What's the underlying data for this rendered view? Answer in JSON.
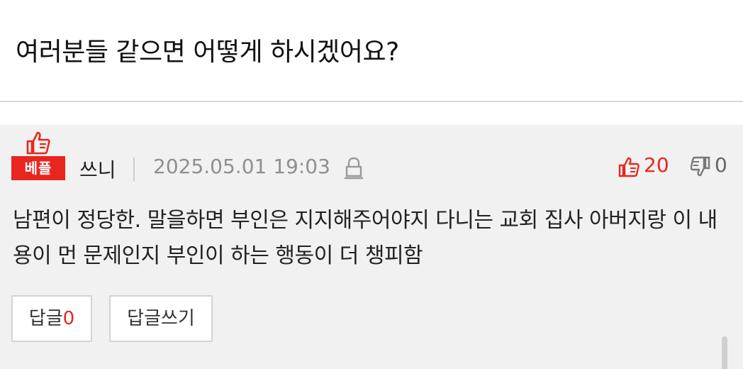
{
  "post": {
    "title": "여러분들 같으면 어떻게 하시겠어요?"
  },
  "comment": {
    "badge_label": "베플",
    "author": "쓰니",
    "date": "2025.05.01 19:03",
    "likes": "20",
    "dislikes": "0",
    "text": "남편이 정당한. 말을하면 부인은 지지해주어야지 다니는 교회 집사 아버지랑 이 내용이 먼 문제인지 부인이 하는 행동이 더 챙피함",
    "reply_label": "답글",
    "reply_count": "0",
    "write_reply_label": "답글쓰기"
  },
  "colors": {
    "accent": "#e8261f",
    "muted": "#8f8f8f",
    "comment_bg": "#f1f1f1"
  },
  "icons": [
    "thumbs-up-icon",
    "lock-icon",
    "like-icon",
    "dislike-icon"
  ]
}
